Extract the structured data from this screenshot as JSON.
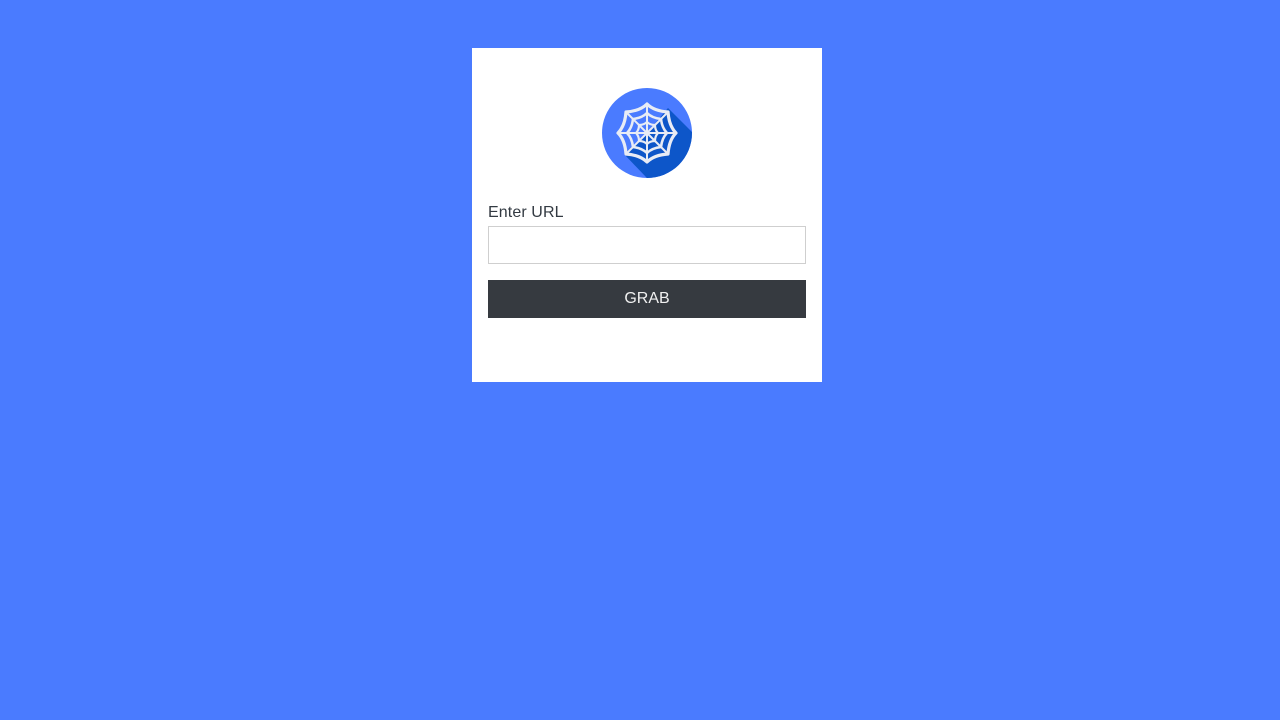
{
  "form": {
    "logo_icon": "spider-web-icon",
    "url_label": "Enter URL",
    "url_input": {
      "value": "",
      "placeholder": ""
    },
    "submit_label": "GRAB"
  },
  "colors": {
    "background": "#4a7bff",
    "card": "#ffffff",
    "logo_circle": "#4a7bff",
    "logo_shadow": "#0d56c9",
    "button": "#363a40",
    "button_text": "#f0f0f0"
  }
}
